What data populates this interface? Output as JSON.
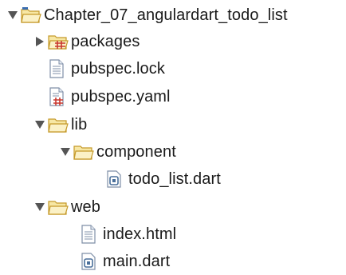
{
  "tree": {
    "root": {
      "label": "Chapter_07_angulardart_todo_list",
      "expanded": true,
      "icon": "project-folder-icon"
    },
    "packages": {
      "label": "packages",
      "expanded": false,
      "icon": "packages-folder-icon"
    },
    "pubspec_lock": {
      "label": "pubspec.lock",
      "icon": "text-file-icon"
    },
    "pubspec_yaml": {
      "label": "pubspec.yaml",
      "icon": "yaml-file-icon"
    },
    "lib": {
      "label": "lib",
      "expanded": true,
      "icon": "folder-icon"
    },
    "component": {
      "label": "component",
      "expanded": true,
      "icon": "folder-icon"
    },
    "todo_list_dart": {
      "label": "todo_list.dart",
      "icon": "dart-file-icon"
    },
    "web": {
      "label": "web",
      "expanded": true,
      "icon": "folder-icon"
    },
    "index_html": {
      "label": "index.html",
      "icon": "html-file-icon"
    },
    "main_dart": {
      "label": "main.dart",
      "icon": "dart-file-icon"
    }
  },
  "colors": {
    "folder_fill": "#f7e7a4",
    "folder_stroke": "#c59a2a",
    "triangle": "#555555",
    "file_stroke": "#7f8fa8",
    "package_red": "#c9382f",
    "dart_blue": "#4a6f9a"
  }
}
